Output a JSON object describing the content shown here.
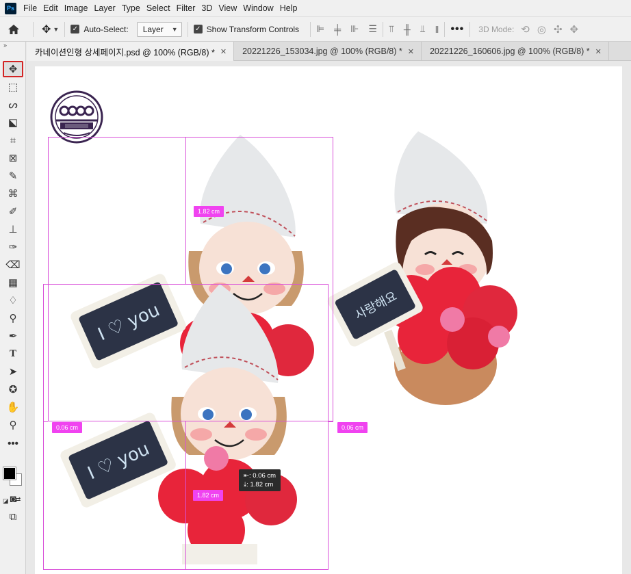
{
  "app": {
    "logo": "Ps"
  },
  "menu": [
    "File",
    "Edit",
    "Image",
    "Layer",
    "Type",
    "Select",
    "Filter",
    "3D",
    "View",
    "Window",
    "Help"
  ],
  "options": {
    "auto_select_label": "Auto-Select:",
    "auto_select_value": "Layer",
    "show_transform_label": "Show Transform Controls",
    "mode_3d_label": "3D Mode:"
  },
  "tabs": [
    {
      "label": "카네이션인형 상세페이지.psd @ 100% (RGB/8) *"
    },
    {
      "label": "20221226_153034.jpg @ 100% (RGB/8) *"
    },
    {
      "label": "20221226_160606.jpg @ 100% (RGB/8) *"
    }
  ],
  "measure": {
    "top_vertical": "1.82 cm",
    "left_horizontal": "0.06 cm",
    "right_horizontal": "0.06 cm",
    "bottom_vertical": "1.82 cm",
    "tooltip_h": "0.06 cm",
    "tooltip_v": "1.82 cm"
  },
  "artwork": {
    "sign_left_top": "I ♡ you",
    "sign_left_bottom": "I ♡ you",
    "sign_right": "사랑해요"
  },
  "colors": {
    "guide": "#d94fd9",
    "badge": "#f043f0",
    "active_tool_border": "#d32424",
    "carnation_red": "#e8243a"
  },
  "icons": {
    "tools": [
      "move-icon",
      "marquee-icon",
      "lasso-icon",
      "object-select-icon",
      "crop-icon",
      "frame-icon",
      "eyedropper-icon",
      "healing-icon",
      "brush-icon",
      "stamp-icon",
      "history-brush-icon",
      "eraser-icon",
      "gradient-icon",
      "blur-icon",
      "dodge-icon",
      "pen-icon",
      "type-icon",
      "path-select-icon",
      "shape-icon",
      "hand-icon",
      "zoom-icon",
      "more-tools-icon"
    ]
  }
}
